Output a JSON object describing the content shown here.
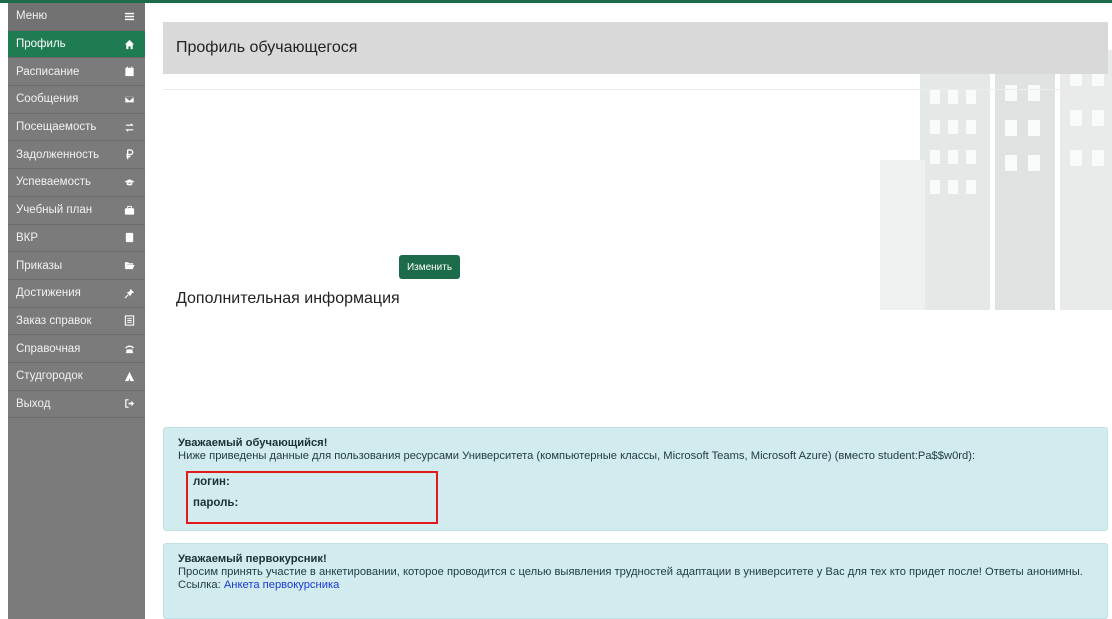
{
  "sidebar": {
    "items": [
      {
        "label": "Меню",
        "icon": "menu-icon"
      },
      {
        "label": "Профиль",
        "icon": "home-icon"
      },
      {
        "label": "Расписание",
        "icon": "calendar-icon"
      },
      {
        "label": "Сообщения",
        "icon": "envelope-icon"
      },
      {
        "label": "Посещаемость",
        "icon": "arrows-icon"
      },
      {
        "label": "Задолженность",
        "icon": "ruble-icon"
      },
      {
        "label": "Успеваемость",
        "icon": "graduation-cap-icon"
      },
      {
        "label": "Учебный план",
        "icon": "briefcase-icon"
      },
      {
        "label": "ВКР",
        "icon": "book-icon"
      },
      {
        "label": "Приказы",
        "icon": "folder-open-icon"
      },
      {
        "label": "Достижения",
        "icon": "pin-icon"
      },
      {
        "label": "Заказ справок",
        "icon": "list-icon"
      },
      {
        "label": "Справочная",
        "icon": "phone-icon"
      },
      {
        "label": "Студгородок",
        "icon": "tent-icon"
      },
      {
        "label": "Выход",
        "icon": "logout-icon"
      }
    ]
  },
  "main": {
    "title": "Профиль обучающегося",
    "edit_button": "Изменить",
    "extra_title": "Дополнительная информация"
  },
  "alert_credentials": {
    "heading": "Уважаемый обучающийся!",
    "text": "Ниже приведены данные для пользования ресурсами Университета (компьютерные классы, Microsoft Teams, Microsoft Azure) (вместо student:Pa$$w0rd):",
    "login_label": "логин:",
    "password_label": "пароль:"
  },
  "alert_freshman": {
    "heading": "Уважаемый первокурсник!",
    "text": "Просим принять участие в анкетировании, которое проводится с целью выявления трудностей адаптации в университете у Вас для тех кто придет после! Ответы анонимны.",
    "link_prefix": "Ссылка: ",
    "link_text": "Анкета первокурсника"
  },
  "colors": {
    "accent": "#1e7b52",
    "sidebar": "#7b7b7b",
    "alert_bg": "#d2ebee",
    "highlight_border": "#e01b1b"
  }
}
